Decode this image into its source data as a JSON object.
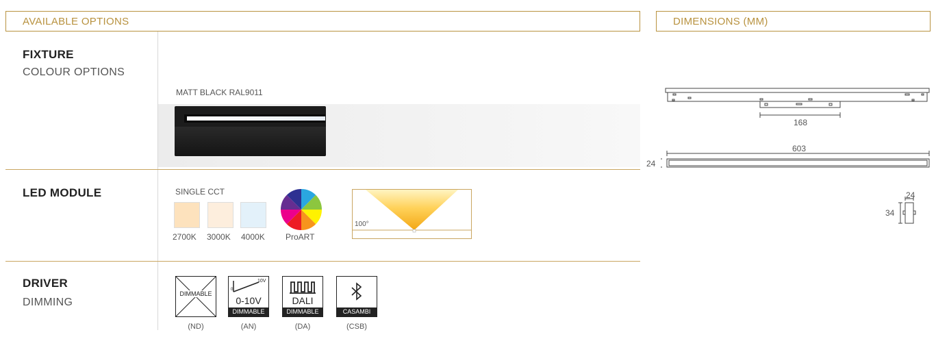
{
  "headers": {
    "left": "AVAILABLE OPTIONS",
    "right": "DIMENSIONS (MM)"
  },
  "fixture": {
    "title": "FIXTURE",
    "subtitle": "COLOUR OPTIONS",
    "finish_label": "MATT BLACK RAL9011"
  },
  "led": {
    "title": "LED MODULE",
    "single_cct_label": "SINGLE CCT",
    "swatches": [
      {
        "label": "2700K",
        "color": "#fde2bd"
      },
      {
        "label": "3000K",
        "color": "#fdeedd"
      },
      {
        "label": "4000K",
        "color": "#e3f1fa"
      }
    ],
    "proart_label": "ProART",
    "beam_angle": "100°"
  },
  "driver": {
    "title": "DRIVER",
    "subtitle": "DIMMING",
    "options": [
      {
        "icon": "non-dimmable-icon",
        "top_text": "DIMMABLE",
        "band": "",
        "code": "(ND)"
      },
      {
        "icon": "analog-dimming-icon",
        "top_text": "0-10V",
        "small_low": "0",
        "small_high": "10V",
        "band": "DIMMABLE",
        "code": "(AN)"
      },
      {
        "icon": "dali-icon",
        "top_text": "DALI",
        "band": "DIMMABLE",
        "code": "(DA)"
      },
      {
        "icon": "bluetooth-icon",
        "top_text": "",
        "band": "CASAMBI",
        "code": "(CSB)"
      }
    ]
  },
  "dimensions": {
    "bracket_spacing": "168",
    "length": "603",
    "height_side": "24",
    "profile_width": "24",
    "profile_height": "34"
  },
  "colors": {
    "accent": "#b8923f",
    "divider": "#d8d8d8"
  }
}
